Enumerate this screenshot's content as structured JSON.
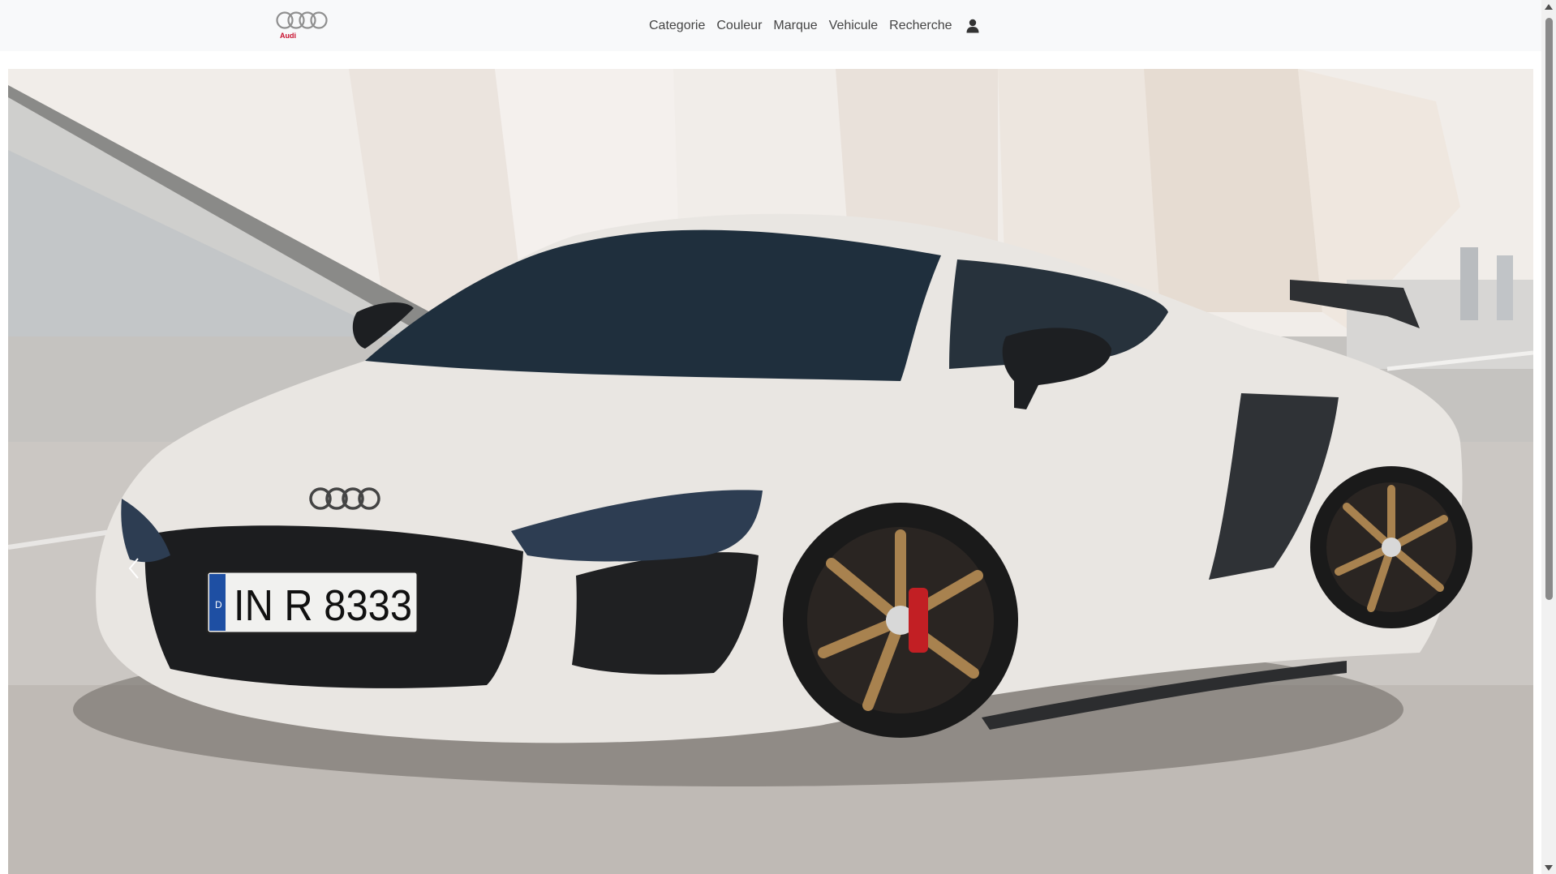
{
  "brand": {
    "name": "Audi",
    "logo_icon": "audi-four-rings-icon",
    "color": "#c8102e"
  },
  "nav": {
    "items": [
      {
        "label": "Categorie"
      },
      {
        "label": "Couleur"
      },
      {
        "label": "Marque"
      },
      {
        "label": "Vehicule"
      },
      {
        "label": "Recherche"
      }
    ],
    "user_icon": "user-icon"
  },
  "hero": {
    "image": "white-audi-r8-sports-car",
    "plate": "IN R 8333",
    "plate_country": "D",
    "prev_icon": "chevron-left-icon"
  },
  "colors": {
    "navbar_bg": "#f8f9fa",
    "nav_text": "#444444",
    "car_body": "#e9e6e2",
    "wheel_bronze": "#a8824f"
  }
}
